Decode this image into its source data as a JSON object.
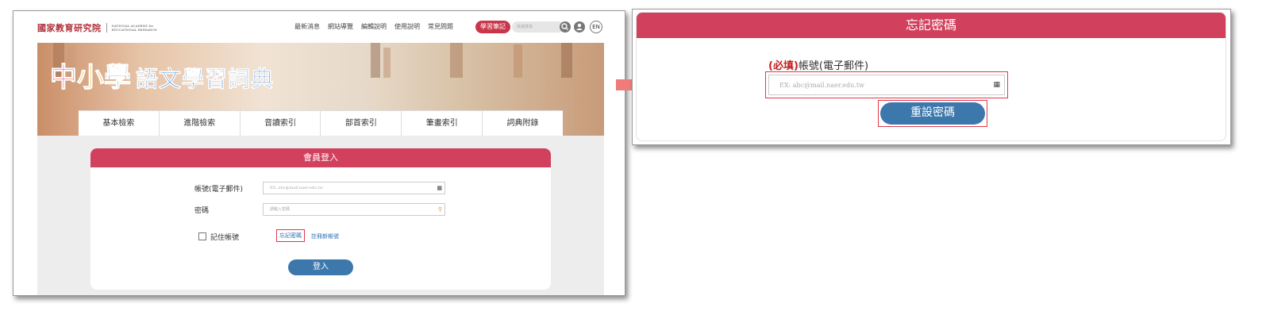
{
  "left_screen": {
    "logo": {
      "zh": "國家教育研究院",
      "en_line1": "NATIONAL ACADEMY for",
      "en_line2": "EDUCATIONAL RESEARCH"
    },
    "nav": [
      "最新消息",
      "網站導覽",
      "編輯說明",
      "使用說明",
      "常見問題"
    ],
    "nav_highlight": "學習筆記",
    "search_placeholder": "快速搜尋",
    "search_icon": "search-icon",
    "user_icon": "user-icon",
    "lang_button": "EN",
    "hero": {
      "title_chars": [
        "中",
        "小",
        "學"
      ],
      "title_colors": [
        "#e8505b",
        "#f3b331",
        "#5bb3c8"
      ],
      "subtitle": "語文學習詞典"
    },
    "tabs": [
      "基本檢索",
      "進階檢索",
      "音讀索引",
      "部首索引",
      "筆畫索引",
      "詞典附錄"
    ],
    "login": {
      "title": "會員登入",
      "account_label": "帳號(電子郵件)",
      "account_placeholder": "EX: abc@mail.naer.edu.tw",
      "password_label": "密碼",
      "password_placeholder": "請輸入密碼",
      "remember_label": "記住帳號",
      "forgot_link": "忘記密碼",
      "register_link": "註冊新帳號",
      "login_button": "登入"
    }
  },
  "right_screen": {
    "title": "忘記密碼",
    "required_tag": "(必填)",
    "account_label": "帳號(電子郵件)",
    "email_placeholder": "EX: abc@mail.naer.edu.tw",
    "reset_button": "重設密碼"
  },
  "colors": {
    "header_red": "#d1405c",
    "button_blue": "#3d78ad",
    "highlight_border": "#e0394b",
    "arrow": "#f07b7b"
  }
}
